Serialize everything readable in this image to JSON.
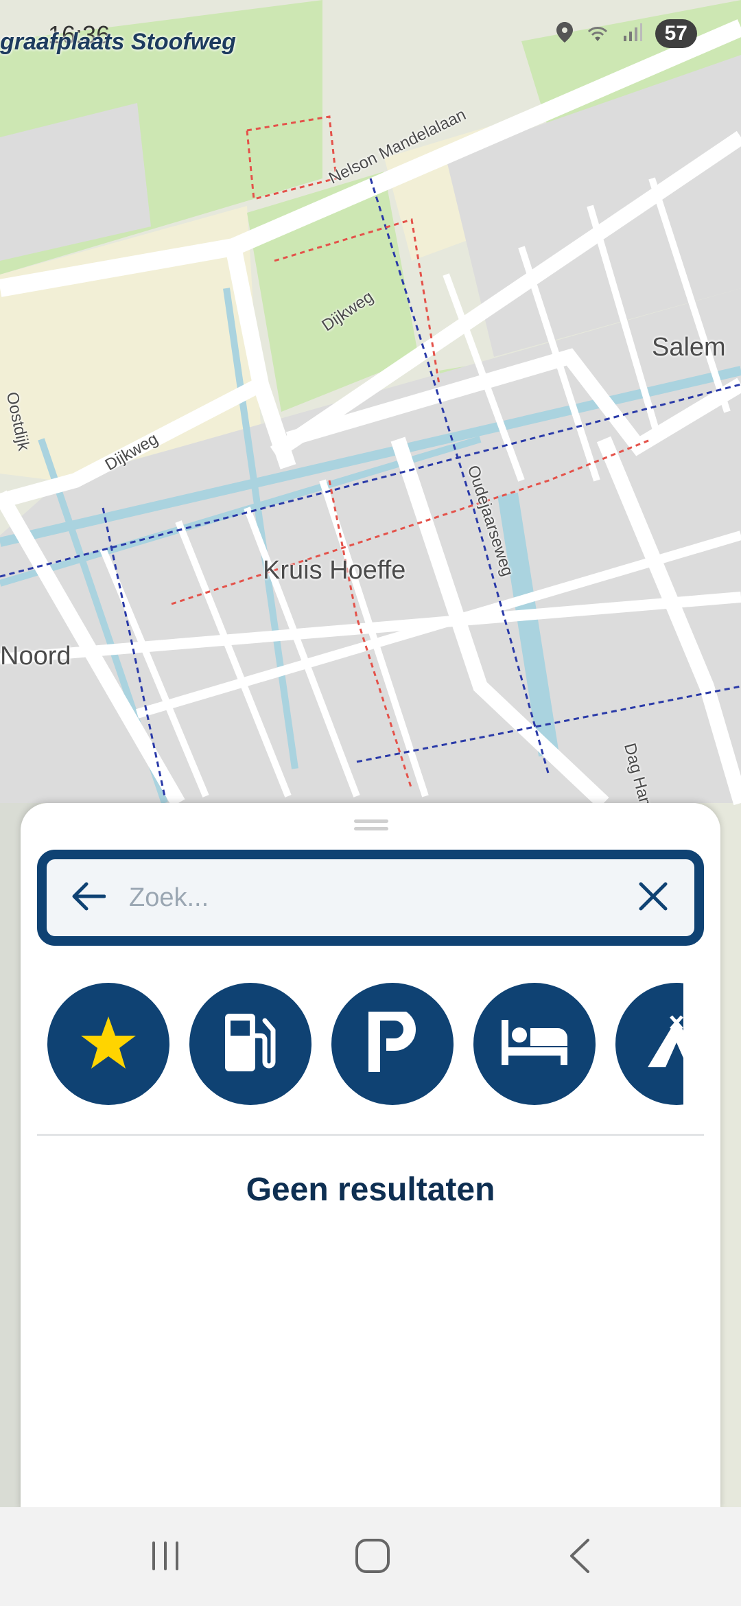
{
  "status_bar": {
    "time": "16:36",
    "battery": "57",
    "overlay_place_label": "graafplaats Stoofweg",
    "icons": [
      "location-icon",
      "wifi-icon",
      "signal-icon",
      "battery-icon"
    ]
  },
  "map": {
    "labels": {
      "area_salem": "Salem",
      "area_kruis_hoeffe": "Kruis Hoeffe",
      "area_noord": "Noord",
      "street_nelson": "Nelson Mandelalaan",
      "street_dijkweg_1": "Dijkweg",
      "street_dijkweg_2": "Dijkweg",
      "street_oudejaarseweg": "Oudejaarseweg",
      "street_dag": "Dag Hammarskjöldlaan",
      "street_oostdijk": "Oostdijk"
    }
  },
  "search": {
    "placeholder": "Zoek...",
    "value": ""
  },
  "categories": [
    {
      "name": "favorites",
      "icon": "star-icon"
    },
    {
      "name": "fuel",
      "icon": "fuel-pump-icon"
    },
    {
      "name": "parking",
      "icon": "parking-icon"
    },
    {
      "name": "lodging",
      "icon": "bed-icon"
    },
    {
      "name": "camping",
      "icon": "tent-icon"
    }
  ],
  "results": {
    "empty_text": "Geen resultaten"
  },
  "colors": {
    "primary": "#0f4273",
    "star": "#ffd400",
    "text_dark": "#0e2f52"
  },
  "nav_bar": {
    "icons": [
      "recent-apps-icon",
      "home-icon",
      "back-icon"
    ]
  }
}
